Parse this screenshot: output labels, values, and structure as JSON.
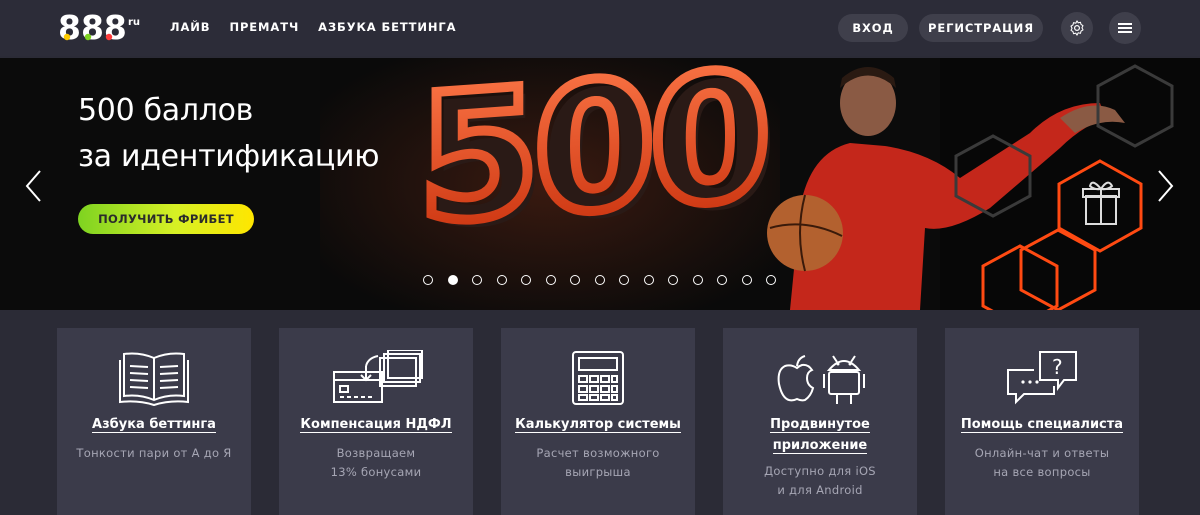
{
  "header": {
    "logo_text": "888",
    "logo_suffix": "ru",
    "nav": [
      "ЛАЙВ",
      "ПРЕМАТЧ",
      "АЗБУКА БЕТТИНГА"
    ],
    "login_label": "ВХОД",
    "register_label": "РЕГИСТРАЦИЯ",
    "settings_icon": "gear-icon",
    "menu_icon": "hamburger-icon"
  },
  "banner": {
    "title_line1": "500 баллов",
    "title_line2": "за идентификацию",
    "cta_label": "ПОЛУЧИТЬ ФРИБЕТ",
    "big_number": "500",
    "slide_count": 15,
    "active_slide": 2,
    "colors": {
      "accent_orange": "#ff4a12",
      "cta_start": "#7ed321",
      "cta_end": "#ffe600"
    }
  },
  "cards": [
    {
      "icon": "book-icon",
      "title": "Азбука беттинга",
      "desc": [
        "Тонкости пари от А до Я"
      ]
    },
    {
      "icon": "card-payment-icon",
      "title": "Компенсация НДФЛ",
      "desc": [
        "Возвращаем",
        "13% бонусами"
      ]
    },
    {
      "icon": "calculator-icon",
      "title": "Калькулятор системы",
      "desc": [
        "Расчет возможного",
        "выигрыша"
      ]
    },
    {
      "icon": "apple-android-icon",
      "title_lines": [
        "Продвинутое",
        "приложение"
      ],
      "desc": [
        "Доступно для iOS",
        "и для Android"
      ]
    },
    {
      "icon": "chat-help-icon",
      "title": "Помощь специалиста",
      "desc": [
        "Онлайн-чат и ответы",
        "на все вопросы"
      ]
    }
  ]
}
